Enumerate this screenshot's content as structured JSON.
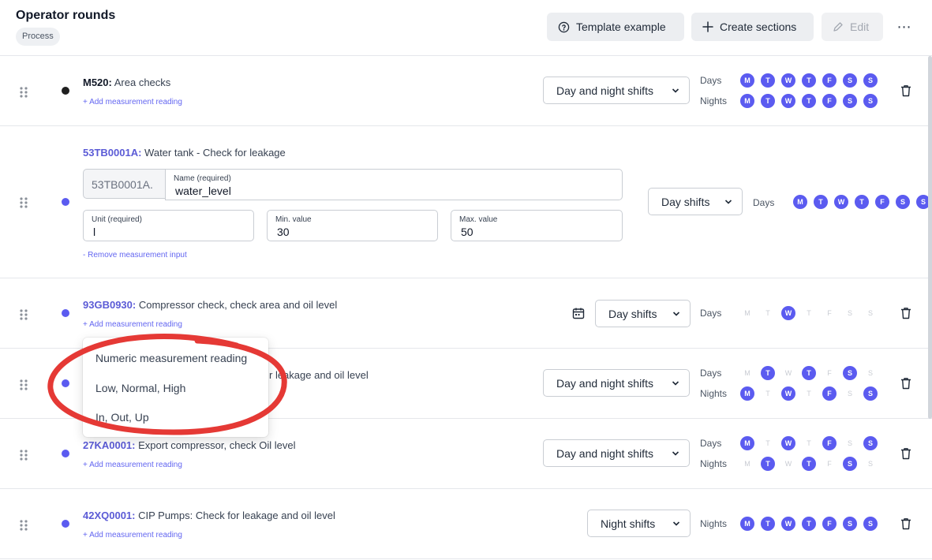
{
  "header": {
    "title": "Operator rounds",
    "chip": "Process",
    "template_btn": "Template example",
    "create_btn": "Create sections",
    "edit_btn": "Edit",
    "more": "⋯"
  },
  "labels": {
    "days": "Days",
    "nights": "Nights"
  },
  "add_link": "+ Add measurement reading",
  "rows": [
    {
      "code": "M520:",
      "text": " Area checks",
      "shift": "Day and night shifts",
      "days": [
        [
          "M",
          1
        ],
        [
          "T",
          1
        ],
        [
          "W",
          1
        ],
        [
          "T",
          1
        ],
        [
          "F",
          1
        ],
        [
          "S",
          1
        ],
        [
          "S",
          1
        ]
      ],
      "nights": [
        [
          "M",
          1
        ],
        [
          "T",
          1
        ],
        [
          "W",
          1
        ],
        [
          "T",
          1
        ],
        [
          "F",
          1
        ],
        [
          "S",
          1
        ],
        [
          "S",
          1
        ]
      ]
    },
    {
      "code": "53TB0001A:",
      "text": " Water tank - Check for leakage",
      "shift": "Day shifts",
      "days": [
        [
          "M",
          1
        ],
        [
          "T",
          1
        ],
        [
          "W",
          1
        ],
        [
          "T",
          1
        ],
        [
          "F",
          1
        ],
        [
          "S",
          1
        ],
        [
          "S",
          1
        ]
      ],
      "form": {
        "prefix": "53TB0001A.",
        "name_label": "Name (required)",
        "name_value": "water_level",
        "unit_label": "Unit (required)",
        "unit_value": "l",
        "min_label": "Min. value",
        "min_value": "30",
        "max_label": "Max. value",
        "max_value": "50",
        "remove_link": "- Remove measurement input"
      }
    },
    {
      "code": "93GB0930:",
      "text": " Compressor check, check area and oil level",
      "shift": "Day shifts",
      "days": [
        [
          "M",
          0
        ],
        [
          "T",
          0
        ],
        [
          "W",
          1
        ],
        [
          "T",
          0
        ],
        [
          "F",
          0
        ],
        [
          "S",
          0
        ],
        [
          "S",
          0
        ]
      ]
    },
    {
      "text_visible": "r leakage and oil level",
      "shift": "Day and night shifts",
      "days": [
        [
          "M",
          0
        ],
        [
          "T",
          1
        ],
        [
          "W",
          0
        ],
        [
          "T",
          1
        ],
        [
          "F",
          0
        ],
        [
          "S",
          1
        ],
        [
          "S",
          0
        ]
      ],
      "nights": [
        [
          "M",
          1
        ],
        [
          "T",
          0
        ],
        [
          "W",
          1
        ],
        [
          "T",
          0
        ],
        [
          "F",
          1
        ],
        [
          "S",
          0
        ],
        [
          "S",
          1
        ]
      ]
    },
    {
      "code": "27KA0001:",
      "text": " Export compressor, check Oil level",
      "shift": "Day and night shifts",
      "days": [
        [
          "M",
          1
        ],
        [
          "T",
          0
        ],
        [
          "W",
          1
        ],
        [
          "T",
          0
        ],
        [
          "F",
          1
        ],
        [
          "S",
          0
        ],
        [
          "S",
          1
        ]
      ],
      "nights": [
        [
          "M",
          0
        ],
        [
          "T",
          1
        ],
        [
          "W",
          0
        ],
        [
          "T",
          1
        ],
        [
          "F",
          0
        ],
        [
          "S",
          1
        ],
        [
          "S",
          0
        ]
      ]
    },
    {
      "code": "42XQ0001:",
      "text": " CIP Pumps: Check for leakage and oil level",
      "shift": "Night shifts",
      "nights": [
        [
          "M",
          1
        ],
        [
          "T",
          1
        ],
        [
          "W",
          1
        ],
        [
          "T",
          1
        ],
        [
          "F",
          1
        ],
        [
          "S",
          1
        ],
        [
          "S",
          1
        ]
      ]
    }
  ],
  "dropdown": {
    "items": [
      "Numeric measurement reading",
      "Low, Normal, High",
      "In, Out, Up"
    ]
  },
  "colors": {
    "accent": "#5b5bf0",
    "annotation": "#e53935"
  }
}
